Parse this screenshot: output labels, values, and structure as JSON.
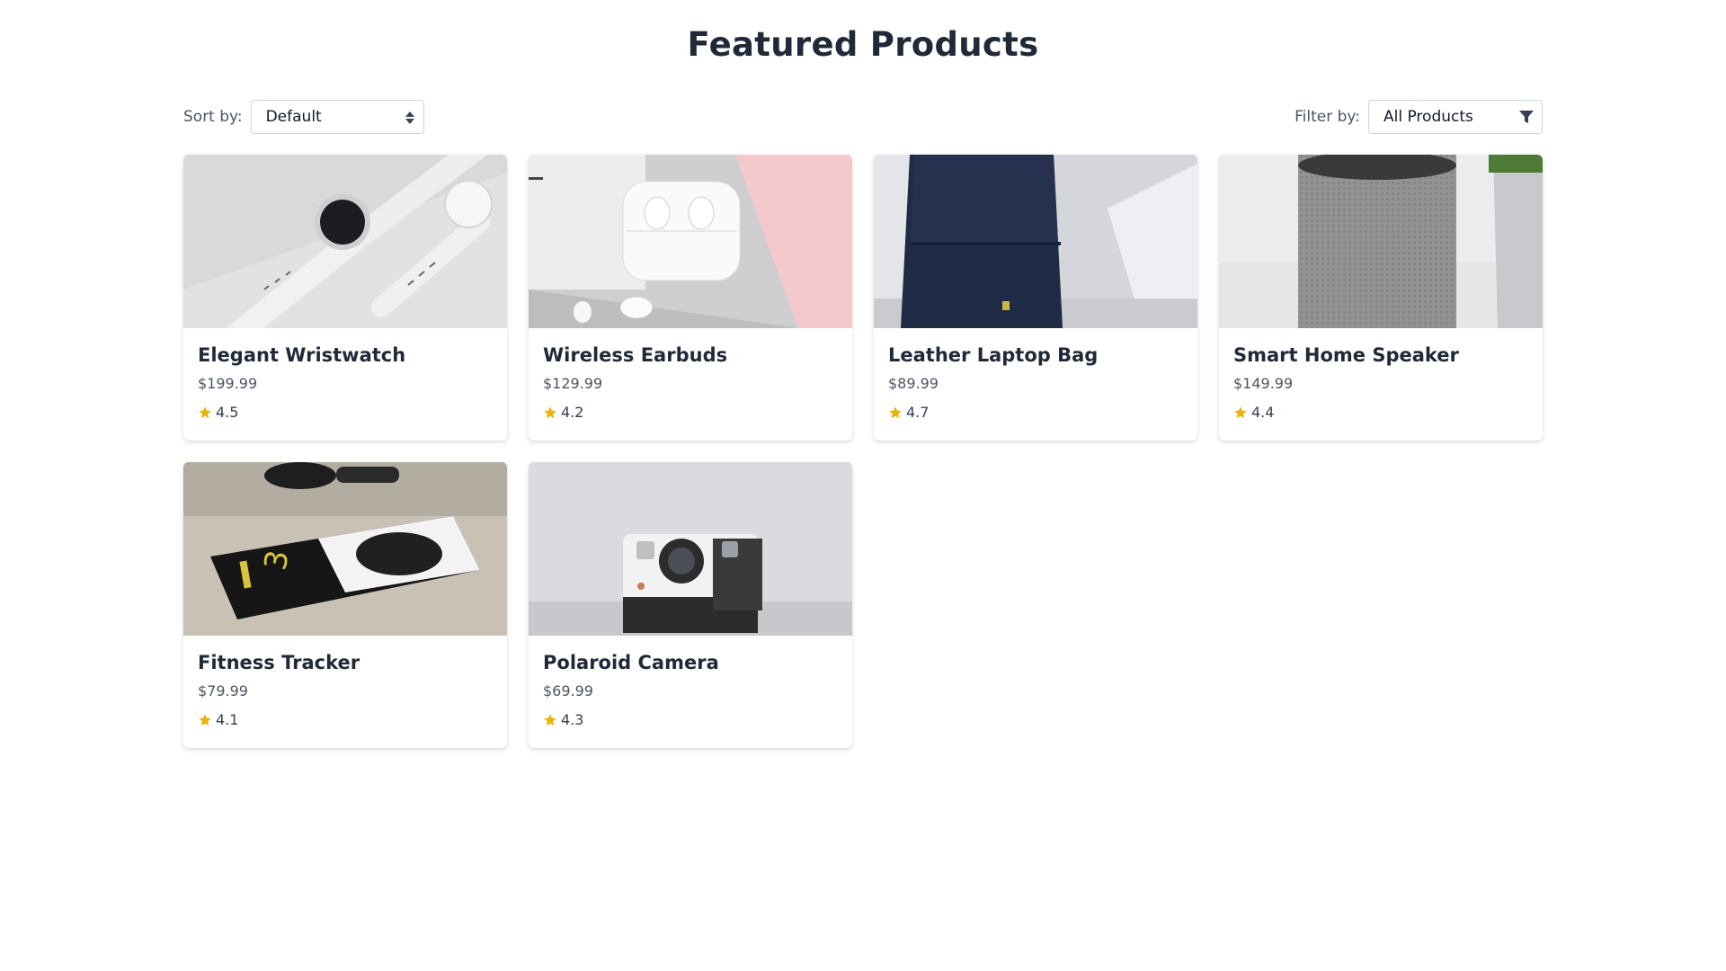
{
  "page": {
    "title": "Featured Products"
  },
  "controls": {
    "sort_label": "Sort by:",
    "sort_value": "Default",
    "filter_label": "Filter by:",
    "filter_value": "All Products"
  },
  "colors": {
    "star": "#eab308",
    "heading": "#1f2937"
  },
  "products": [
    {
      "name": "Elegant Wristwatch",
      "price": "$199.99",
      "rating": "4.5",
      "image": "smartwatch-photo"
    },
    {
      "name": "Wireless Earbuds",
      "price": "$129.99",
      "rating": "4.2",
      "image": "earbuds-photo"
    },
    {
      "name": "Leather Laptop Bag",
      "price": "$89.99",
      "rating": "4.7",
      "image": "backpack-photo"
    },
    {
      "name": "Smart Home Speaker",
      "price": "$149.99",
      "rating": "4.4",
      "image": "smart-speaker-photo"
    },
    {
      "name": "Fitness Tracker",
      "price": "$79.99",
      "rating": "4.1",
      "image": "fitness-tracker-photo"
    },
    {
      "name": "Polaroid Camera",
      "price": "$69.99",
      "rating": "4.3",
      "image": "instant-camera-photo"
    }
  ]
}
